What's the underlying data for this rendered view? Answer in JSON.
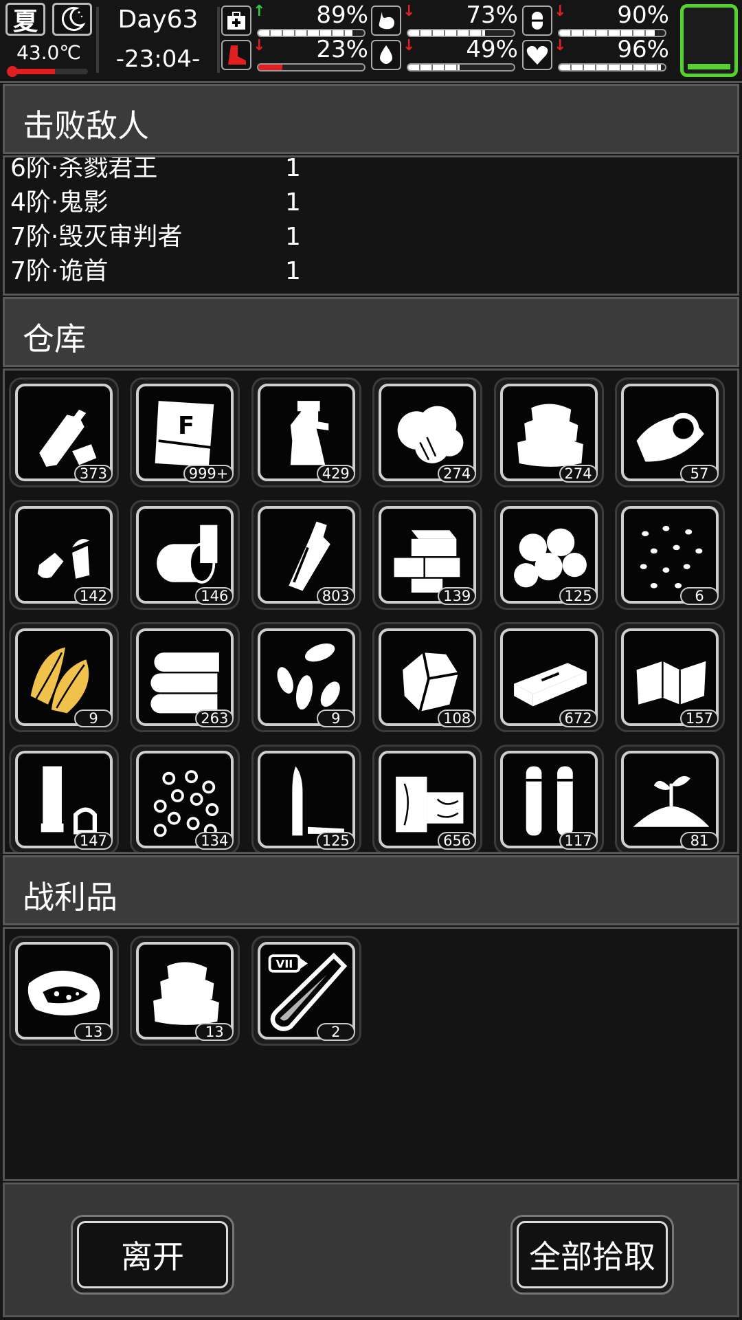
{
  "status": {
    "season": "夏",
    "temperature": "43.0℃",
    "temperature_level": 0.55,
    "day": "Day63",
    "clock": "-23:04-",
    "stats": [
      {
        "icon": "medkit-icon",
        "trend": "up",
        "value": "89%",
        "level": 0.89
      },
      {
        "icon": "stomach-icon",
        "trend": "down",
        "value": "73%",
        "level": 0.73
      },
      {
        "icon": "pill-icon",
        "trend": "down",
        "value": "90%",
        "level": 0.9
      },
      {
        "icon": "boot-icon",
        "trend": "down",
        "value": "23%",
        "level": 0.23
      },
      {
        "icon": "water-drop-icon",
        "trend": "down",
        "value": "49%",
        "level": 0.49
      },
      {
        "icon": "heart-icon",
        "trend": "down",
        "value": "96%",
        "level": 0.96
      }
    ],
    "battery_level": 0.08,
    "colors": {
      "up": "#2ecc40",
      "down": "#e02020",
      "battery": "#57d12e"
    }
  },
  "defeated": {
    "title": "击败敌人",
    "enemies": [
      {
        "name": "6阶·杀戮君王",
        "count": "1"
      },
      {
        "name": "4阶·鬼影",
        "count": "1"
      },
      {
        "name": "7阶·毁灭审判者",
        "count": "1"
      },
      {
        "name": "7阶·诡首",
        "count": "1"
      }
    ]
  },
  "warehouse": {
    "title": "仓库",
    "items": [
      {
        "icon": "plastic-bottle-icon",
        "qty": "373"
      },
      {
        "icon": "fertilizer-bag-icon",
        "qty": "999+",
        "bag_letter": "F"
      },
      {
        "icon": "spray-bottle-icon",
        "qty": "429"
      },
      {
        "icon": "cotton-icon",
        "qty": "274"
      },
      {
        "icon": "cloth-stack-icon",
        "qty": "274"
      },
      {
        "icon": "cloth-roll-icon",
        "qty": "57"
      },
      {
        "icon": "bullets-icon",
        "qty": "142"
      },
      {
        "icon": "cans-icon",
        "qty": "146"
      },
      {
        "icon": "glass-bottle-icon",
        "qty": "803"
      },
      {
        "icon": "bricks-icon",
        "qty": "139"
      },
      {
        "icon": "ore-icon",
        "qty": "125"
      },
      {
        "icon": "seeds-icon",
        "qty": "6"
      },
      {
        "icon": "tobacco-leaf-icon",
        "qty": "9"
      },
      {
        "icon": "logs-icon",
        "qty": "263"
      },
      {
        "icon": "sunflower-seeds-icon",
        "qty": "9"
      },
      {
        "icon": "crystal-rock-icon",
        "qty": "108"
      },
      {
        "icon": "steel-bar-icon",
        "qty": "672"
      },
      {
        "icon": "leather-icon",
        "qty": "157"
      },
      {
        "icon": "shotgun-shell-icon",
        "qty": "147"
      },
      {
        "icon": "pellets-icon",
        "qty": "134"
      },
      {
        "icon": "rifle-bullet-icon",
        "qty": "125"
      },
      {
        "icon": "wood-planks-icon",
        "qty": "656"
      },
      {
        "icon": "cartridges-icon",
        "qty": "117"
      },
      {
        "icon": "soil-sprout-icon",
        "qty": "81"
      }
    ]
  },
  "loot": {
    "title": "战利品",
    "items": [
      {
        "icon": "meat-icon",
        "qty": "13"
      },
      {
        "icon": "cloth-stack-icon",
        "qty": "13"
      },
      {
        "icon": "serum-vial-icon",
        "qty": "2",
        "tier": "VII"
      }
    ]
  },
  "actions": {
    "leave": "离开",
    "take_all": "全部拾取"
  }
}
